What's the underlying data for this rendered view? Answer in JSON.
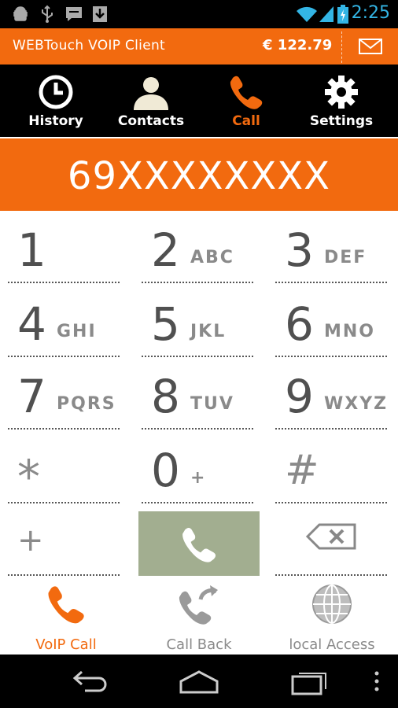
{
  "status_bar": {
    "time": "2:25",
    "icons": [
      "android-debug-icon",
      "usb-icon",
      "message-icon",
      "download-icon",
      "wifi-icon",
      "signal-icon",
      "battery-charging-icon"
    ]
  },
  "header": {
    "title": "WEBTouch VOIP Client",
    "balance": "€ 122.79",
    "mail_icon": "mail-icon"
  },
  "tabs": [
    {
      "label": "History",
      "icon": "clock-icon",
      "active": false
    },
    {
      "label": "Contacts",
      "icon": "person-icon",
      "active": false
    },
    {
      "label": "Call",
      "icon": "phone-icon",
      "active": true
    },
    {
      "label": "Settings",
      "icon": "gear-icon",
      "active": false
    }
  ],
  "dialer": {
    "number": "69XXXXXXXX"
  },
  "keypad": {
    "keys": [
      {
        "digit": "1",
        "letters": ""
      },
      {
        "digit": "2",
        "letters": "ABC"
      },
      {
        "digit": "3",
        "letters": "DEF"
      },
      {
        "digit": "4",
        "letters": "GHI"
      },
      {
        "digit": "5",
        "letters": "JKL"
      },
      {
        "digit": "6",
        "letters": "MNO"
      },
      {
        "digit": "7",
        "letters": "PQRS"
      },
      {
        "digit": "8",
        "letters": "TUV"
      },
      {
        "digit": "9",
        "letters": "WXYZ"
      },
      {
        "digit": "*",
        "letters": ""
      },
      {
        "digit": "0",
        "letters": "+"
      },
      {
        "digit": "#",
        "letters": ""
      },
      {
        "digit": "+",
        "letters": ""
      }
    ],
    "call_icon": "phone-icon",
    "backspace_icon": "backspace-icon"
  },
  "actions": [
    {
      "label": "VoIP Call",
      "icon": "phone-icon",
      "active": true
    },
    {
      "label": "Call Back",
      "icon": "callback-icon",
      "active": false
    },
    {
      "label": "local Access",
      "icon": "globe-icon",
      "active": false
    }
  ],
  "nav": {
    "icons": [
      "back-icon",
      "home-icon",
      "recent-apps-icon",
      "overflow-menu-icon"
    ]
  },
  "colors": {
    "accent": "#f26a0f",
    "call_button": "#a2ae90",
    "status_time": "#33b5e5"
  }
}
